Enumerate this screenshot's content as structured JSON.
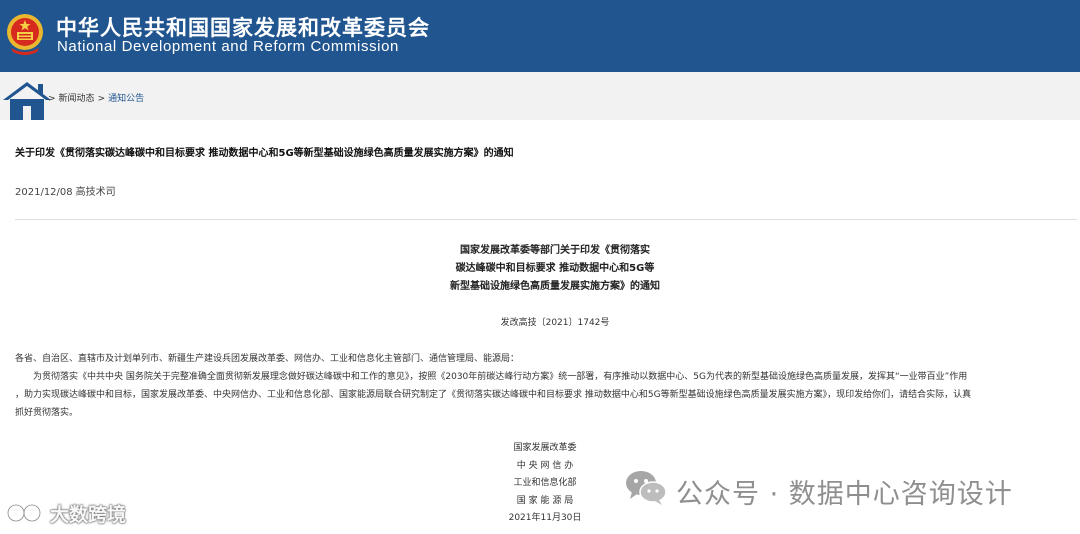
{
  "header": {
    "title_cn": "中华人民共和国国家发展和改革委员会",
    "title_en": "National Development and Reform Commission",
    "background_color": "#21558f"
  },
  "breadcrumb": {
    "home_icon": "home-icon",
    "items": [
      ">",
      "新闻动态",
      ">",
      "通知公告"
    ]
  },
  "article": {
    "title": "关于印发《贯彻落实碳达峰碳中和目标要求 推动数据中心和5G等新型基础设施绿色高质量发展实施方案》的通知",
    "date": "2021/12/08",
    "department": "高技术司"
  },
  "document": {
    "heading_lines": [
      "国家发展改革委等部门关于印发《贯彻落实",
      "碳达峰碳中和目标要求 推动数据中心和5G等",
      "新型基础设施绿色高质量发展实施方案》的通知"
    ],
    "number": "发改高技〔2021〕1742号",
    "paragraphs": [
      "各省、自治区、直辖市及计划单列市、新疆生产建设兵团发展改革委、网信办、工业和信息化主管部门、通信管理局、能源局：",
      "　　为贯彻落实《中共中央 国务院关于完整准确全面贯彻新发展理念做好碳达峰碳中和工作的意见》，按照《2030年前碳达峰行动方案》统一部署，有序推动以数据中心、5G为代表的新型基础设施绿色高质量发展，发挥其“一业带百业”作用",
      "，助力实现碳达峰碳中和目标，国家发展改革委、中央网信办、工业和信息化部、国家能源局联合研究制定了《贯彻落实碳达峰碳中和目标要求 推动数据中心和5G等新型基础设施绿色高质量发展实施方案》，现印发给你们，请结合实际，认真",
      "抓好贯彻落实。"
    ],
    "signatories": [
      "国家发展改革委",
      "中 央 网 信 办",
      "工业和信息化部",
      "国 家 能 源 局"
    ],
    "sign_date": "2021年11月30日"
  },
  "watermarks": {
    "left_text": "大数跨境",
    "right_text": "公众号 · 数据中心咨询设计"
  }
}
